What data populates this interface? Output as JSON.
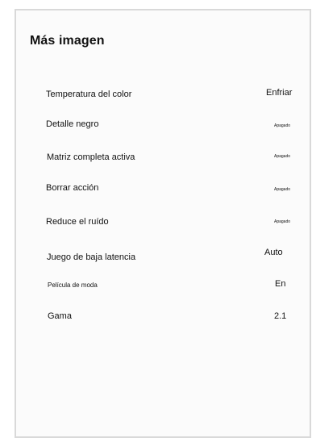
{
  "menu": {
    "title": "Más imagen",
    "items": [
      {
        "label": "Temperatura del color",
        "value": "Enfriar"
      },
      {
        "label": "Detalle negro",
        "value": "Apagado"
      },
      {
        "label": "Matriz completa activa",
        "value": "Apagado"
      },
      {
        "label": "Borrar acción",
        "value": "Apagado"
      },
      {
        "label": "Reduce el ruído",
        "value": "Apagado"
      },
      {
        "label": "Juego de baja latencia",
        "value": "Auto"
      },
      {
        "label": "Película de moda",
        "value": "En"
      },
      {
        "label": "Gama",
        "value": "2.1"
      }
    ]
  }
}
